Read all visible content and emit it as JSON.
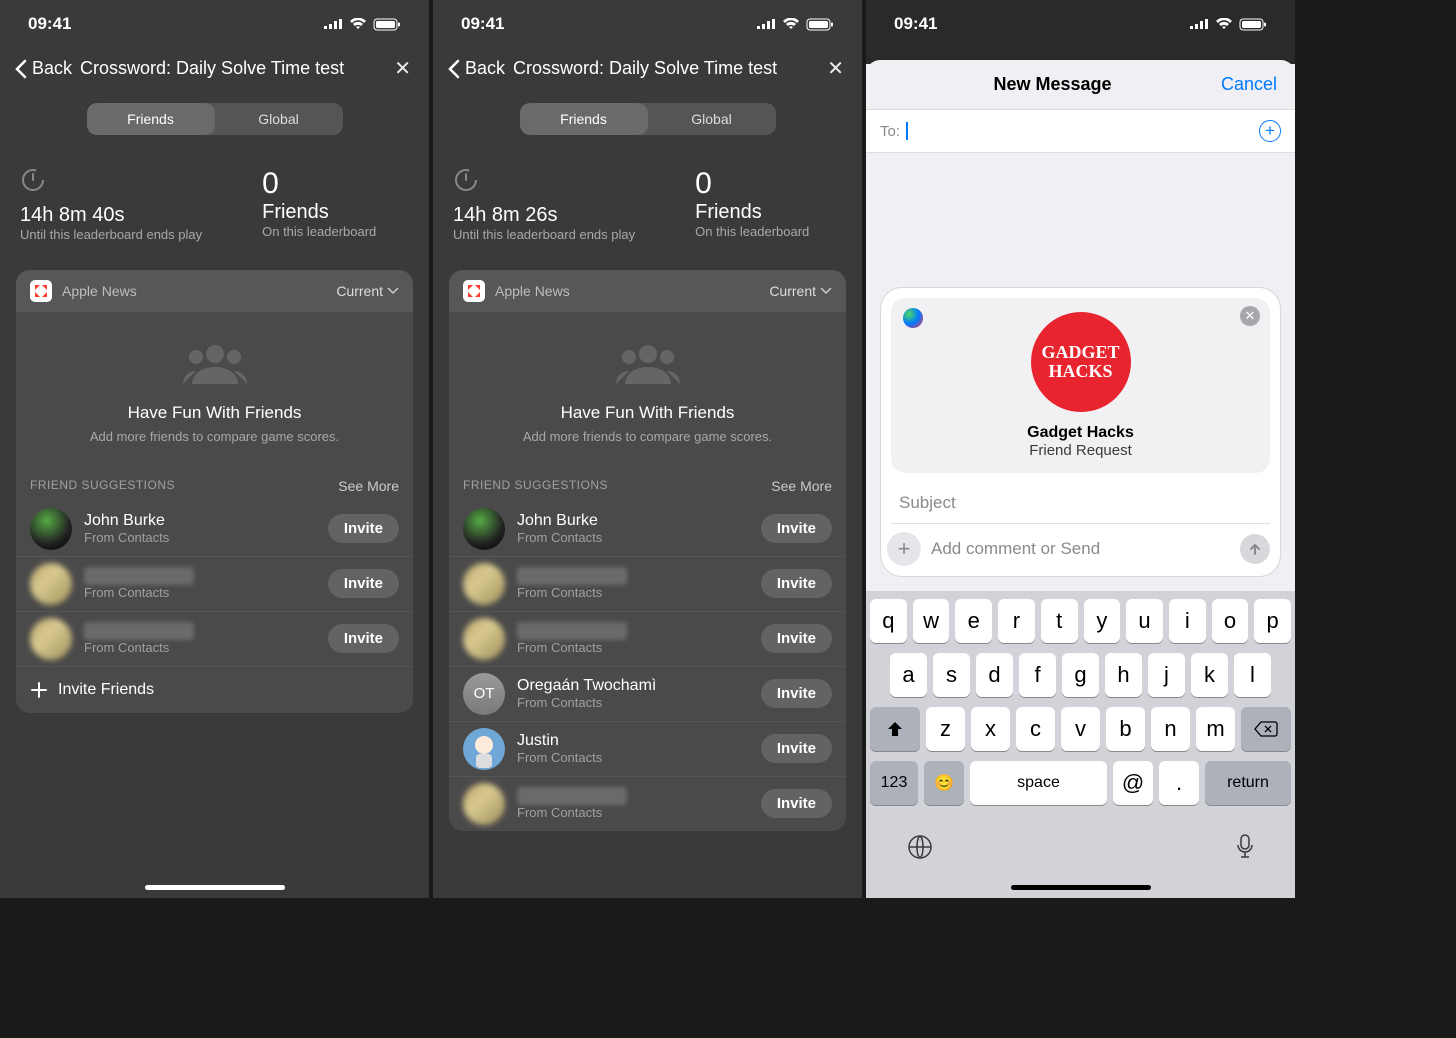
{
  "statusbar": {
    "time": "09:41"
  },
  "nav": {
    "back": "Back",
    "title": "Crossword: Daily Solve Time test"
  },
  "segment": {
    "friends": "Friends",
    "global": "Global"
  },
  "stats_a": {
    "time": "14h 8m 40s",
    "time_sub": "Until this leaderboard ends play",
    "friends_count": "0",
    "friends_label": "Friends",
    "friends_sub": "On this leaderboard"
  },
  "stats_b": {
    "time": "14h 8m 26s",
    "time_sub": "Until this leaderboard ends play",
    "friends_count": "0",
    "friends_label": "Friends",
    "friends_sub": "On this leaderboard"
  },
  "card": {
    "source": "Apple News",
    "current": "Current",
    "hero_title": "Have Fun With Friends",
    "hero_sub": "Add more friends to compare game scores.",
    "section": "FRIEND SUGGESTIONS",
    "see_more": "See More",
    "invite": "Invite",
    "from_contacts": "From Contacts",
    "invite_friends": "Invite Friends"
  },
  "suggestions_a": [
    {
      "name": "John Burke",
      "show": true,
      "avatar": "dark"
    },
    {
      "name": "",
      "show": false,
      "avatar": "blurred"
    },
    {
      "name": "",
      "show": false,
      "avatar": "blurred"
    }
  ],
  "suggestions_b": [
    {
      "name": "John Burke",
      "show": true,
      "avatar": "dark"
    },
    {
      "name": "",
      "show": false,
      "avatar": "blurred"
    },
    {
      "name": "",
      "show": false,
      "avatar": "blurred"
    },
    {
      "name": "Oregaán Twochamì",
      "show": true,
      "avatar": "grey",
      "initials": "OT"
    },
    {
      "name": "Justin",
      "show": true,
      "avatar": "memoji"
    },
    {
      "name": "",
      "show": false,
      "avatar": "blurred"
    }
  ],
  "message": {
    "title": "New Message",
    "cancel": "Cancel",
    "to_label": "To:",
    "att_logo": "GADGET HACKS",
    "att_title": "Gadget Hacks",
    "att_sub": "Friend Request",
    "subject_ph": "Subject",
    "compose_ph": "Add comment or Send"
  },
  "keyboard": {
    "r1": [
      "q",
      "w",
      "e",
      "r",
      "t",
      "y",
      "u",
      "i",
      "o",
      "p"
    ],
    "r2": [
      "a",
      "s",
      "d",
      "f",
      "g",
      "h",
      "j",
      "k",
      "l"
    ],
    "r3": [
      "z",
      "x",
      "c",
      "v",
      "b",
      "n",
      "m"
    ],
    "num": "123",
    "space": "space",
    "at": "@",
    "dot": ".",
    "ret": "return"
  }
}
